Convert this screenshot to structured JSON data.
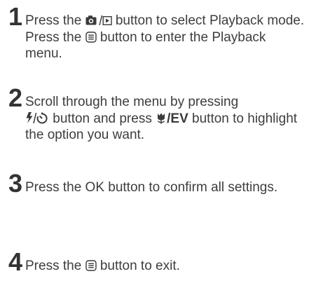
{
  "steps": [
    {
      "number": "1",
      "parts": {
        "a": "Press the ",
        "b": " button to select Playback mode. Press the ",
        "c": " button to enter the Playback menu."
      }
    },
    {
      "number": "2",
      "parts": {
        "a": "Scroll through the menu by pressing ",
        "b": " button and press ",
        "ev_label": "EV",
        "c": " button to highlight the option you want."
      }
    },
    {
      "number": "3",
      "parts": {
        "a": "Press the OK button to confirm all settings."
      }
    },
    {
      "number": "4",
      "parts": {
        "a": "Press the ",
        "b": " button to exit."
      }
    }
  ],
  "icons": {
    "camera_playback": "camera-playback-icon",
    "menu": "menu-icon",
    "flash_selftimer": "flash-selftimer-icon",
    "macro_ev": "macro-icon"
  },
  "colors": {
    "text": "#3d3d3d",
    "number": "#333333"
  }
}
